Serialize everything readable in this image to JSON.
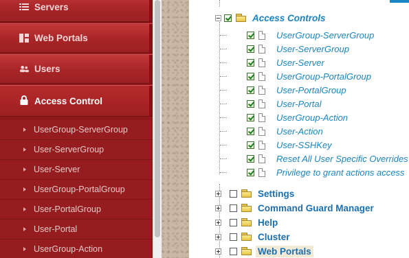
{
  "sidebar": {
    "main_items": [
      {
        "label": "Servers",
        "icon": "list-icon"
      },
      {
        "label": "Web Portals",
        "icon": "grid-icon"
      },
      {
        "label": "Users",
        "icon": "users-icon"
      },
      {
        "label": "Access Control",
        "icon": "lock-icon",
        "active": true
      }
    ],
    "sub_items": [
      {
        "label": "UserGroup-ServerGroup"
      },
      {
        "label": "User-ServerGroup"
      },
      {
        "label": "User-Server"
      },
      {
        "label": "UserGroup-PortalGroup"
      },
      {
        "label": "User-PortalGroup"
      },
      {
        "label": "User-Portal"
      },
      {
        "label": "UserGroup-Action"
      }
    ]
  },
  "tree": {
    "access_controls": {
      "label": "Access Controls",
      "checked": true,
      "children": [
        {
          "label": "UserGroup-ServerGroup",
          "checked": true
        },
        {
          "label": "User-ServerGroup",
          "checked": true
        },
        {
          "label": "User-Server",
          "checked": true
        },
        {
          "label": "UserGroup-PortalGroup",
          "checked": true
        },
        {
          "label": "User-PortalGroup",
          "checked": true
        },
        {
          "label": "User-Portal",
          "checked": true
        },
        {
          "label": "UserGroup-Action",
          "checked": true
        },
        {
          "label": "User-Action",
          "checked": true
        },
        {
          "label": "User-SSHKey",
          "checked": true
        },
        {
          "label": "Reset All User Specific Overrides",
          "checked": true
        },
        {
          "label": "Privilege to grant actions access",
          "checked": true
        }
      ]
    },
    "groups": [
      {
        "label": "Settings",
        "checked": false
      },
      {
        "label": "Command Guard Manager",
        "checked": false
      },
      {
        "label": "Help",
        "checked": false
      },
      {
        "label": "Cluster",
        "checked": false
      },
      {
        "label": "Web Portals",
        "checked": false,
        "highlighted": true
      }
    ]
  },
  "colors": {
    "sidebar_red": "#a82527",
    "link_blue": "#1a86c4",
    "group_blue": "#1b6fb0",
    "texture_beige": "#c9b8a5"
  }
}
